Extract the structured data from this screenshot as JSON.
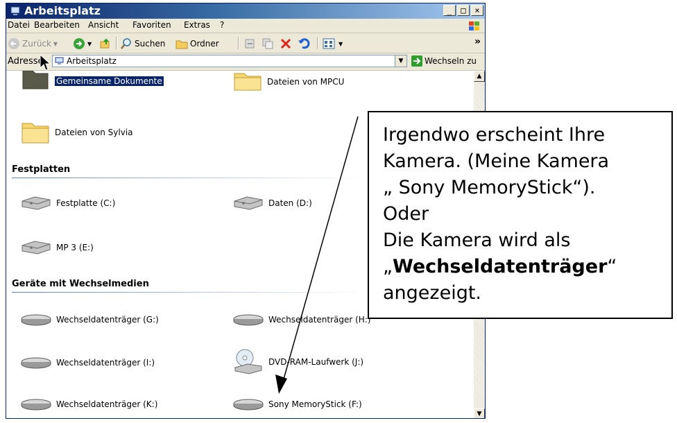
{
  "window": {
    "title": "Arbeitsplatz",
    "buttons": [
      "_",
      "□",
      "×"
    ]
  },
  "menu": [
    "Datei",
    "Bearbeiten",
    "Ansicht",
    "Favoriten",
    "Extras",
    "?"
  ],
  "toolbar": {
    "back": "Zurück",
    "search": "Suchen",
    "folders": "Ordner",
    "more": "»"
  },
  "address": {
    "label": "Adresse",
    "value": "Arbeitsplatz",
    "go": "Wechseln zu"
  },
  "content": {
    "top_items": [
      "Gemeinsame Dokumente",
      "Dateien von MPCU",
      "Dateien von Sylvia"
    ],
    "groups": [
      {
        "heading": "Festplatten",
        "items": [
          "Festplatte (C:)",
          "Daten (D:)",
          "MP 3 (E:)"
        ]
      },
      {
        "heading": "Geräte mit Wechselmedien",
        "items": [
          "Wechseldatenträger (G:)",
          "Wechseldatenträger (H:)",
          "Wechseldatenträger (I:)",
          "DVD-RAM-Laufwerk (J:)",
          "Wechseldatenträger (K:)",
          "Sony MemoryStick (F:)"
        ]
      }
    ]
  },
  "callout": {
    "line1": "Irgendwo erscheint Ihre",
    "line2": "Kamera. (Meine Kamera",
    "line3": "„ Sony MemoryStick“).",
    "line4": "Oder",
    "line5": "Die Kamera wird als",
    "line6_pre": "„",
    "line6_bold": "Wechseldatenträger",
    "line6_post": "“",
    "line7": "angezeigt."
  },
  "colors": {
    "titlebar": "#0a246a",
    "selection": "#0a246a",
    "window_bg": "#ece9d8",
    "go_green": "#2e9e2e"
  }
}
